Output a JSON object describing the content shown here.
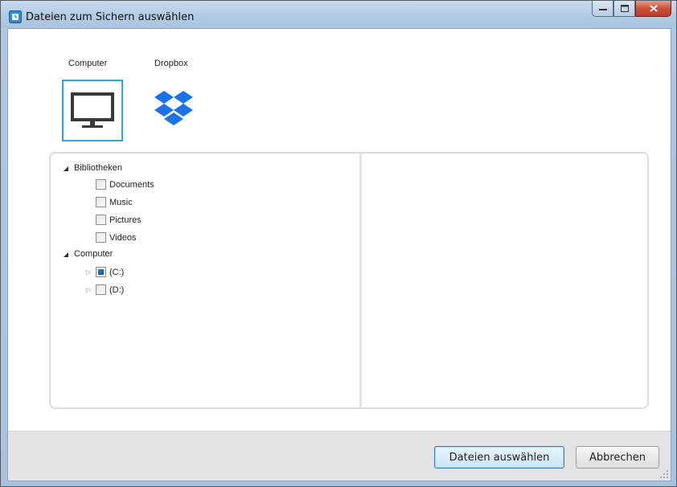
{
  "window": {
    "title": "Dateien zum Sichern auswählen",
    "controls": {
      "minimize": "minimize-icon",
      "maximize": "maximize-icon",
      "close": "close-icon"
    }
  },
  "sources": [
    {
      "label": "Computer",
      "icon": "monitor-icon",
      "selected": true
    },
    {
      "label": "Dropbox",
      "icon": "dropbox-icon",
      "selected": false
    }
  ],
  "tree": {
    "libraries": {
      "label": "Bibliotheken",
      "expanded": true,
      "items": [
        "Documents",
        "Music",
        "Pictures",
        "Videos"
      ]
    },
    "computer": {
      "label": "Computer",
      "expanded": true,
      "drives": [
        {
          "label": "(C:)",
          "state": "partial"
        },
        {
          "label": "(D:)",
          "state": "unchecked"
        }
      ]
    }
  },
  "footer": {
    "select_label": "Dateien auswählen",
    "cancel_label": "Abbrechen"
  },
  "colors": {
    "accent": "#2fa6e3",
    "dropbox": "#1a73e8",
    "close_button": "#c8503a"
  }
}
